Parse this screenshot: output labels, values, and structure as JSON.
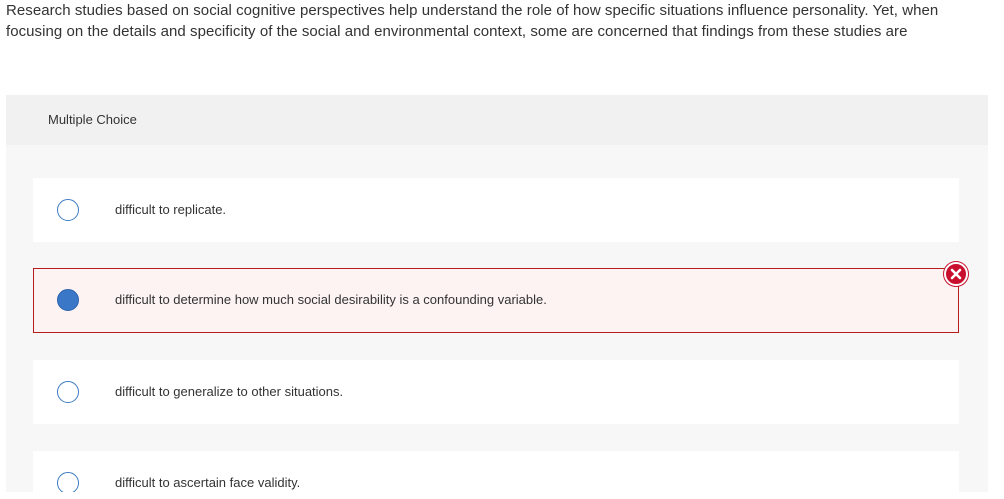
{
  "question": {
    "text": "Research studies based on social cognitive perspectives help understand the role of how specific situations influence personality. Yet, when focusing on the details and specificity of the social and environmental context, some are concerned that findings from these studies are"
  },
  "multiple_choice": {
    "label": "Multiple Choice",
    "options": [
      {
        "text": "difficult to replicate.",
        "selected": false
      },
      {
        "text": "difficult to determine how much social desirability is a confounding variable.",
        "selected": true,
        "marked": "incorrect"
      },
      {
        "text": "difficult to generalize to other situations.",
        "selected": false
      },
      {
        "text": "difficult to ascertain face validity.",
        "selected": false
      }
    ]
  },
  "colors": {
    "radio_accent": "#3a77c7",
    "incorrect": "#c8102e"
  },
  "icons": {
    "incorrect_marker": "x-circle-icon"
  }
}
